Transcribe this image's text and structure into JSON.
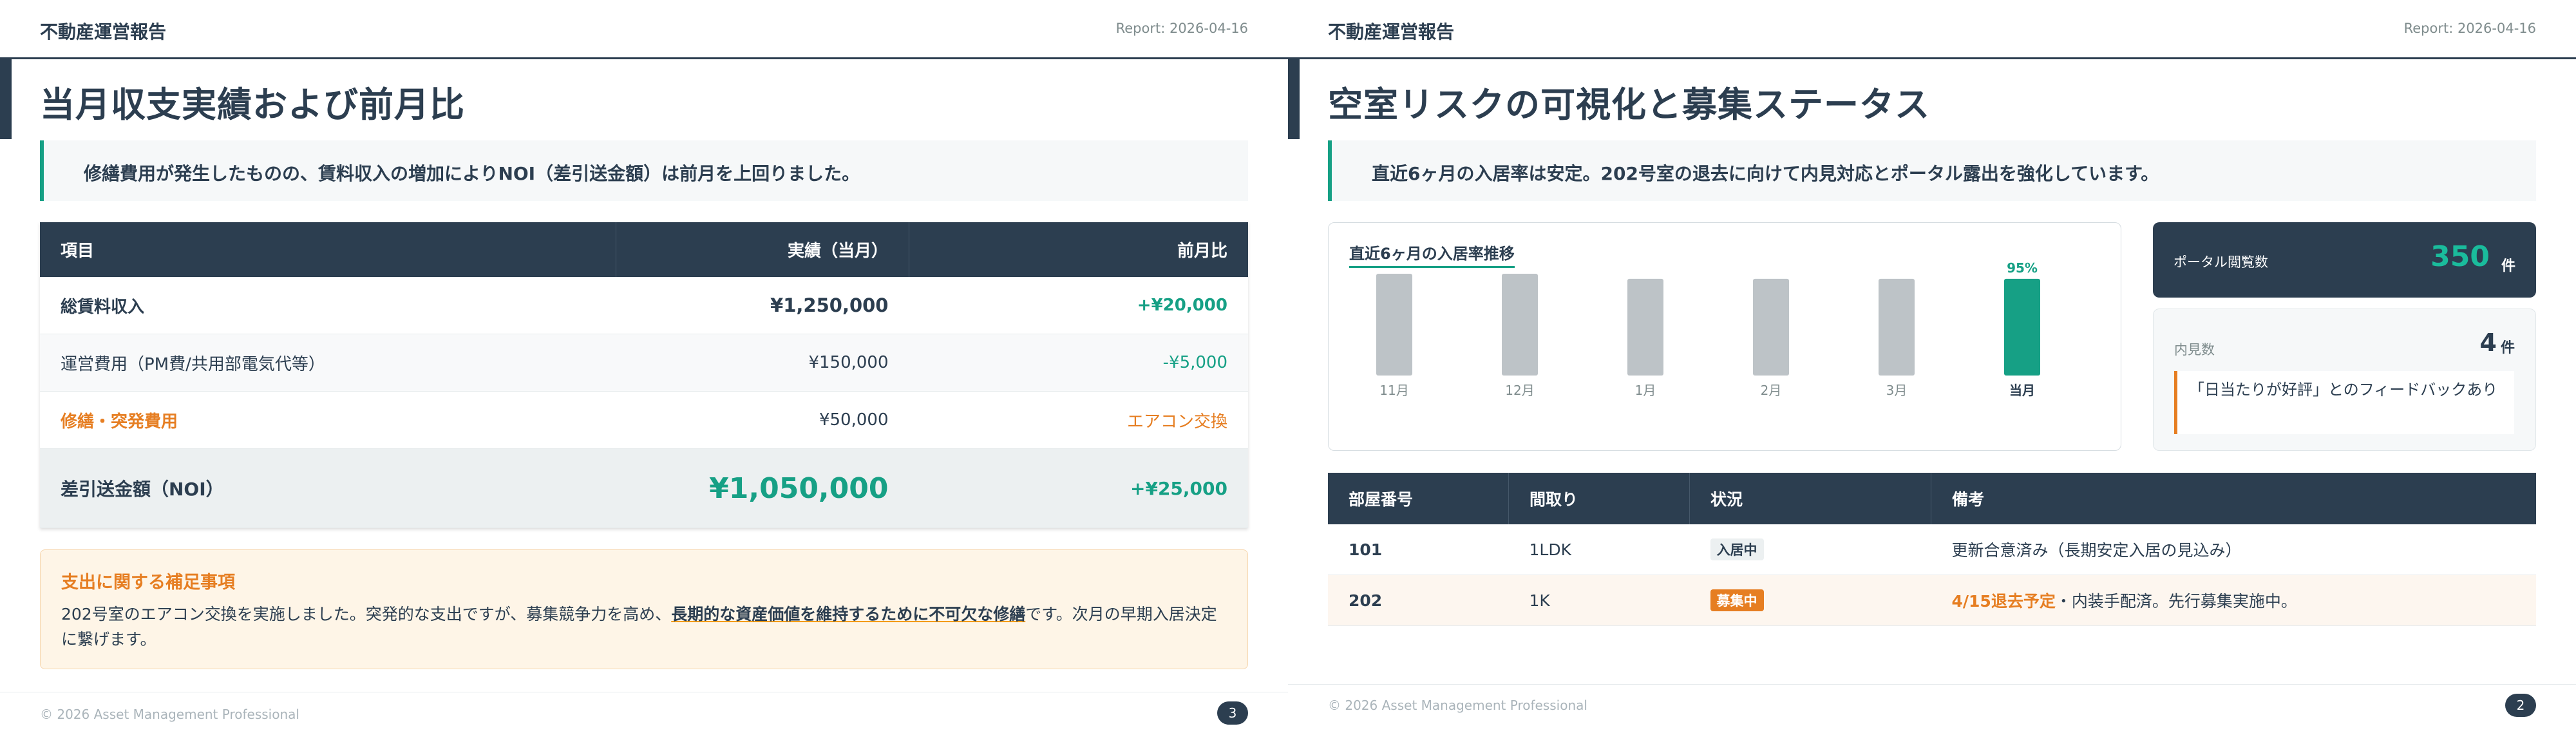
{
  "slide_left": {
    "header": {
      "title": "不動産運営報告",
      "date": "Report: 2026-04-16"
    },
    "title": "当月収支実績および前月比",
    "message": "修繕費用が発生したものの、賃料収入の増加によりNOI（差引送金額）は前月を上回りました。",
    "table": {
      "headers": [
        "項目",
        "実績（当月）",
        "前月比"
      ],
      "rows": [
        {
          "item": "総賃料収入",
          "actual": "¥1,250,000",
          "diff": "+¥20,000"
        },
        {
          "item": "運営費用（PM費/共用部電気代等）",
          "actual": "¥150,000",
          "diff": "-¥5,000"
        },
        {
          "item": "修繕・突発費用",
          "actual": "¥50,000",
          "diff": "エアコン交換"
        },
        {
          "item": "差引送金額（NOI）",
          "actual": "¥1,050,000",
          "diff": "+¥25,000"
        }
      ]
    },
    "note": {
      "title": "支出に関する補足事項",
      "body_before": "202号室のエアコン交換を実施しました。突発的な支出ですが、募集競争力を高め、",
      "body_highlight": "長期的な資産価値を維持するために不可欠な修繕",
      "body_after": "です。次月の早期入居決定に繋げます。"
    },
    "footer": {
      "copyright": "© 2026 Asset Management Professional",
      "page": "3"
    }
  },
  "slide_right": {
    "header": {
      "title": "不動産運営報告",
      "date": "Report: 2026-04-16"
    },
    "title": "空室リスクの可視化と募集ステータス",
    "message": "直近6ヶ月の入居率は安定。202号室の退去に向けて内見対応とポータル露出を強化しています。",
    "chart_title": "直近6ヶ月の入居率推移",
    "metrics": {
      "portal": {
        "label": "ポータル閲覧数",
        "value": "350",
        "unit": "件"
      },
      "viewing": {
        "label": "内見数",
        "value": "4",
        "unit": "件",
        "quote": "「日当たりが好評」とのフィードバックあり"
      }
    },
    "rooms": {
      "headers": [
        "部屋番号",
        "間取り",
        "状況",
        "備考"
      ],
      "rows": [
        {
          "room": "101",
          "layout": "1LDK",
          "status": "入居中",
          "note_highlight": "",
          "note": "更新合意済み（長期安定入居の見込み）"
        },
        {
          "room": "202",
          "layout": "1K",
          "status": "募集中",
          "note_highlight": "4/15退去予定",
          "note": "・内装手配済。先行募集実施中。"
        }
      ]
    },
    "footer": {
      "copyright": "© 2026 Asset Management Professional",
      "page": "2"
    }
  },
  "colors": {
    "navy": "#2c3e50",
    "accent_green": "#16a085",
    "gray_bar": "#bdc3c7",
    "orange": "#e67e22"
  },
  "chart_data": {
    "type": "bar",
    "title": "直近6ヶ月の入居率推移",
    "categories": [
      "11月",
      "12月",
      "1月",
      "2月",
      "3月",
      "当月"
    ],
    "values": [
      100,
      100,
      95,
      95,
      95,
      95
    ],
    "data_labels": [
      "",
      "",
      "",
      "",
      "",
      "95%"
    ],
    "highlight_index": 5,
    "ylim": [
      0,
      100
    ],
    "grid": false
  }
}
